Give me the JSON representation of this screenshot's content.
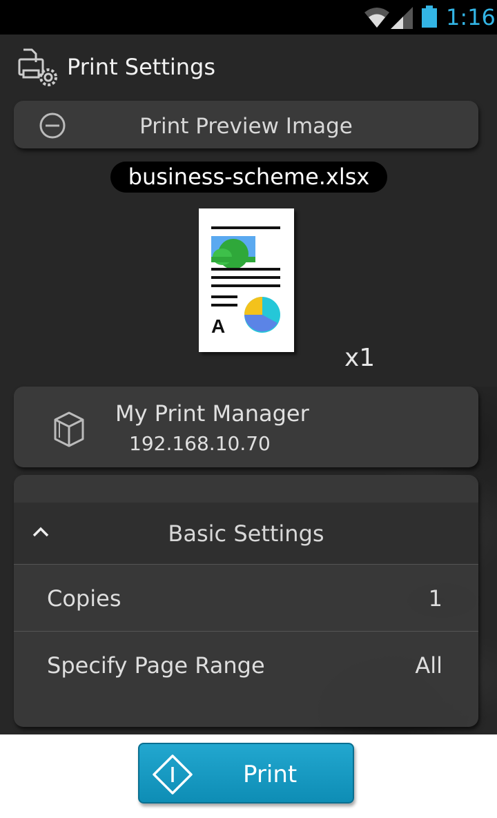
{
  "status_bar": {
    "time": "1:16",
    "icons": [
      "wifi-icon",
      "signal-icon",
      "battery-icon"
    ],
    "accent_color": "#33b5e5"
  },
  "header": {
    "title": "Print Settings",
    "icon": "print-settings-icon"
  },
  "preview": {
    "header_label": "Print Preview Image",
    "collapse_icon": "minus-circle-icon",
    "filename": "business-scheme.xlsx",
    "thumbnail_letter": "A",
    "copies_indicator": "x1"
  },
  "printer": {
    "name": "My Print Manager",
    "address": "192.168.10.70",
    "icon": "printer-box-icon"
  },
  "basic_settings": {
    "header_label": "Basic Settings",
    "expanded": true,
    "rows": [
      {
        "label": "Copies",
        "value": "1"
      },
      {
        "label": "Specify Page Range",
        "value": "All"
      }
    ]
  },
  "action": {
    "print_label": "Print",
    "button_color": "#1a9cc4"
  }
}
